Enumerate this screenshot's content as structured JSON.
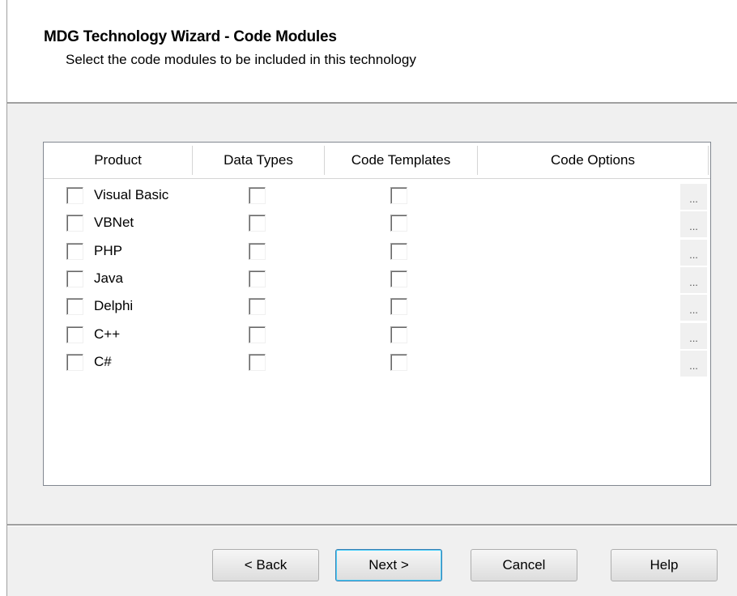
{
  "wizard": {
    "title": "MDG Technology Wizard - Code Modules",
    "subtitle": "Select the code modules to be included in this technology"
  },
  "grid": {
    "columns": [
      "Product",
      "Data Types",
      "Code Templates",
      "Code Options"
    ],
    "rows": [
      {
        "product": "Visual Basic",
        "product_checked": false,
        "data_types_checked": false,
        "code_templates_checked": false,
        "code_options_button": "..."
      },
      {
        "product": "VBNet",
        "product_checked": false,
        "data_types_checked": false,
        "code_templates_checked": false,
        "code_options_button": "..."
      },
      {
        "product": "PHP",
        "product_checked": false,
        "data_types_checked": false,
        "code_templates_checked": false,
        "code_options_button": "..."
      },
      {
        "product": "Java",
        "product_checked": false,
        "data_types_checked": false,
        "code_templates_checked": false,
        "code_options_button": "..."
      },
      {
        "product": "Delphi",
        "product_checked": false,
        "data_types_checked": false,
        "code_templates_checked": false,
        "code_options_button": "..."
      },
      {
        "product": "C++",
        "product_checked": false,
        "data_types_checked": false,
        "code_templates_checked": false,
        "code_options_button": "..."
      },
      {
        "product": "C#",
        "product_checked": false,
        "data_types_checked": false,
        "code_templates_checked": false,
        "code_options_button": "..."
      }
    ]
  },
  "buttons": {
    "back": "< Back",
    "next": "Next >",
    "cancel": "Cancel",
    "help": "Help"
  }
}
